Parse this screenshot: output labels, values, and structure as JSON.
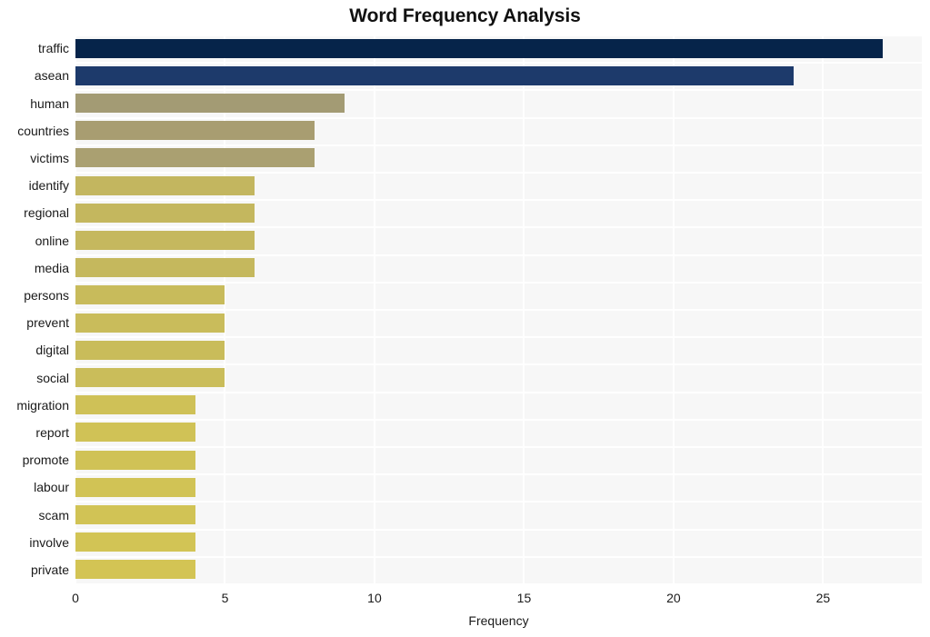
{
  "chart_data": {
    "type": "bar",
    "orientation": "horizontal",
    "title": "Word Frequency Analysis",
    "xlabel": "Frequency",
    "ylabel": "",
    "xlim": [
      0,
      28.3
    ],
    "xticks": [
      0,
      5,
      10,
      15,
      20,
      25
    ],
    "xtick_labels": [
      "0",
      "5",
      "10",
      "15",
      "20",
      "25"
    ],
    "grid": true,
    "grid_color": "#ffffff",
    "plot_background": "#f7f7f7",
    "legend": null,
    "categories": [
      "traffic",
      "asean",
      "human",
      "countries",
      "victims",
      "identify",
      "regional",
      "online",
      "media",
      "persons",
      "prevent",
      "digital",
      "social",
      "migration",
      "report",
      "promote",
      "labour",
      "scam",
      "involve",
      "private"
    ],
    "values": [
      27,
      24,
      9,
      8,
      8,
      6,
      6,
      6,
      6,
      5,
      5,
      5,
      5,
      4,
      4,
      4,
      4,
      4,
      4,
      4
    ],
    "bar_colors": [
      "#06244a",
      "#1d3a6b",
      "#a39b74",
      "#a89d71",
      "#aaa071",
      "#c3b65f",
      "#c4b75e",
      "#c5b85e",
      "#c5b85d",
      "#c8bb5b",
      "#c9bc5b",
      "#c9bc5a",
      "#cabd5a",
      "#cfc157",
      "#d0c256",
      "#d0c256",
      "#d1c355",
      "#d1c355",
      "#d2c455",
      "#d3c454"
    ]
  }
}
